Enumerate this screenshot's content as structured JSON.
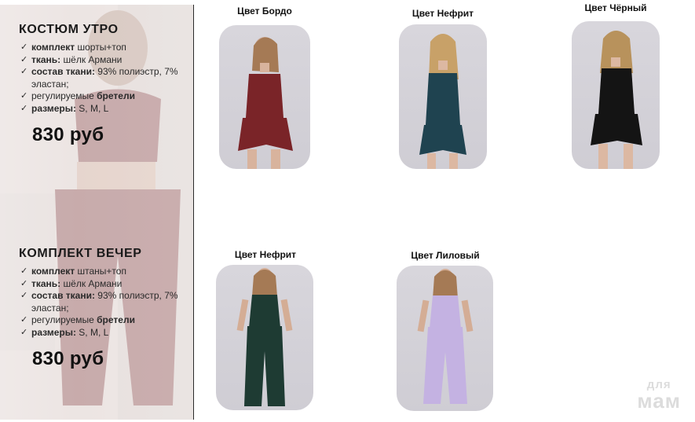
{
  "products": [
    {
      "title": "КОСТЮМ УТРО",
      "features": [
        {
          "label": "комплект",
          "value": " шорты+топ"
        },
        {
          "label": "ткань:",
          "value": " шёлк Армани"
        },
        {
          "label": "состав ткани:",
          "value": " 93% полиэстр, 7% эластан;"
        },
        {
          "label": "",
          "value": "регулируемые ",
          "tail_bold": "бретели"
        },
        {
          "label": "размеры:",
          "value": " S, M, L"
        }
      ],
      "price": "830 руб",
      "colors": [
        {
          "caption": "Цвет Бордо",
          "color": "#7a2428"
        },
        {
          "caption": "Цвет Нефрит",
          "color": "#1f4350"
        },
        {
          "caption": "Цвет Чёрный",
          "color": "#141414"
        }
      ]
    },
    {
      "title": "КОМПЛЕКТ ВЕЧЕР",
      "features": [
        {
          "label": "комплект",
          "value": " штаны+топ"
        },
        {
          "label": "ткань:",
          "value": " шёлк Армани"
        },
        {
          "label": "состав ткани:",
          "value": " 93% полиэстр, 7% эластан;"
        },
        {
          "label": "",
          "value": "регулируемые ",
          "tail_bold": "бретели"
        },
        {
          "label": "размеры:",
          "value": " S, M, L"
        }
      ],
      "price": "830 руб",
      "colors": [
        {
          "caption": "Цвет Нефрит",
          "color": "#1e3b33"
        },
        {
          "caption": "Цвет Лиловый",
          "color": "#c4b2e2"
        }
      ]
    }
  ],
  "watermark": {
    "line1": "для",
    "line2": "мам"
  }
}
